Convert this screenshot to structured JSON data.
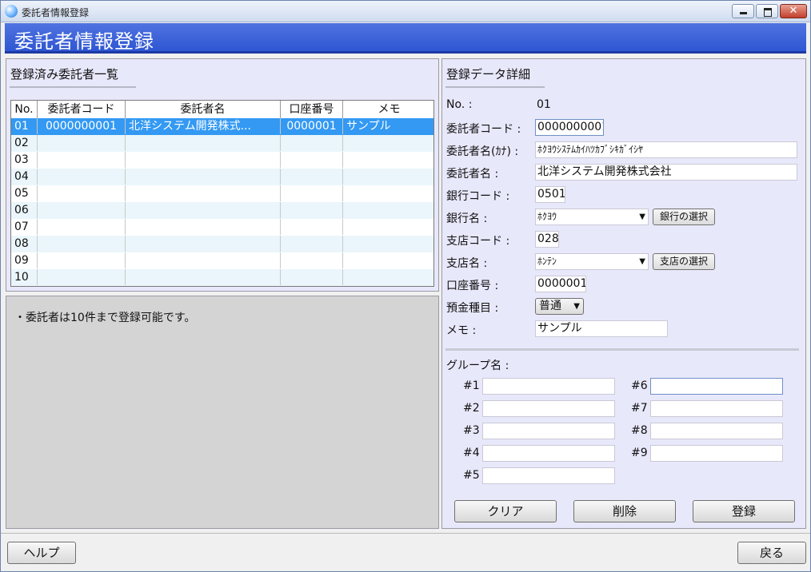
{
  "window": {
    "title": "委託者情報登録"
  },
  "header": {
    "title": "委託者情報登録"
  },
  "list_panel": {
    "title": "登録済み委託者一覧",
    "columns": [
      "No.",
      "委託者コード",
      "委託者名",
      "口座番号",
      "メモ"
    ],
    "rows": [
      {
        "no": "01",
        "code": "0000000001",
        "name": "北洋システム開発株式...",
        "account": "0000001",
        "memo": "サンプル"
      },
      {
        "no": "02",
        "code": "",
        "name": "",
        "account": "",
        "memo": ""
      },
      {
        "no": "03",
        "code": "",
        "name": "",
        "account": "",
        "memo": ""
      },
      {
        "no": "04",
        "code": "",
        "name": "",
        "account": "",
        "memo": ""
      },
      {
        "no": "05",
        "code": "",
        "name": "",
        "account": "",
        "memo": ""
      },
      {
        "no": "06",
        "code": "",
        "name": "",
        "account": "",
        "memo": ""
      },
      {
        "no": "07",
        "code": "",
        "name": "",
        "account": "",
        "memo": ""
      },
      {
        "no": "08",
        "code": "",
        "name": "",
        "account": "",
        "memo": ""
      },
      {
        "no": "09",
        "code": "",
        "name": "",
        "account": "",
        "memo": ""
      },
      {
        "no": "10",
        "code": "",
        "name": "",
        "account": "",
        "memo": ""
      }
    ]
  },
  "note": {
    "text": "・委託者は10件まで登録可能です。"
  },
  "detail_panel": {
    "title": "登録データ詳細",
    "no_label": "No. :",
    "no_value": "01",
    "code_label": "委託者コード :",
    "code_value": "0000000001",
    "kana_label": "委託者名(ｶﾅ) :",
    "kana_value": "ﾎｸﾖｳｼｽﾃﾑｶｲﾊﾂｶﾌﾞｼｷｶﾞｲｼﾔ",
    "name_label": "委託者名 :",
    "name_value": "北洋システム開発株式会社",
    "bank_code_label": "銀行コード :",
    "bank_code_value": "0501",
    "bank_name_label": "銀行名 :",
    "bank_name_value": "ﾎｸﾖｳ",
    "bank_select_button": "銀行の選択",
    "branch_code_label": "支店コード :",
    "branch_code_value": "028",
    "branch_name_label": "支店名 :",
    "branch_name_value": "ﾎﾝﾃﾝ",
    "branch_select_button": "支店の選択",
    "account_label": "口座番号 :",
    "account_value": "0000001",
    "deposit_type_label": "預金種目 :",
    "deposit_type_value": "普通",
    "memo_label": "メモ :",
    "memo_value": "サンプル",
    "group_label": "グループ名 :",
    "groups": [
      {
        "label": "#1",
        "value": ""
      },
      {
        "label": "#2",
        "value": ""
      },
      {
        "label": "#3",
        "value": ""
      },
      {
        "label": "#4",
        "value": ""
      },
      {
        "label": "#5",
        "value": ""
      },
      {
        "label": "#6",
        "value": ""
      },
      {
        "label": "#7",
        "value": ""
      },
      {
        "label": "#8",
        "value": ""
      },
      {
        "label": "#9",
        "value": ""
      }
    ],
    "clear_button": "クリア",
    "delete_button": "削除",
    "register_button": "登録"
  },
  "footer": {
    "help_button": "ヘルプ",
    "back_button": "戻る"
  }
}
